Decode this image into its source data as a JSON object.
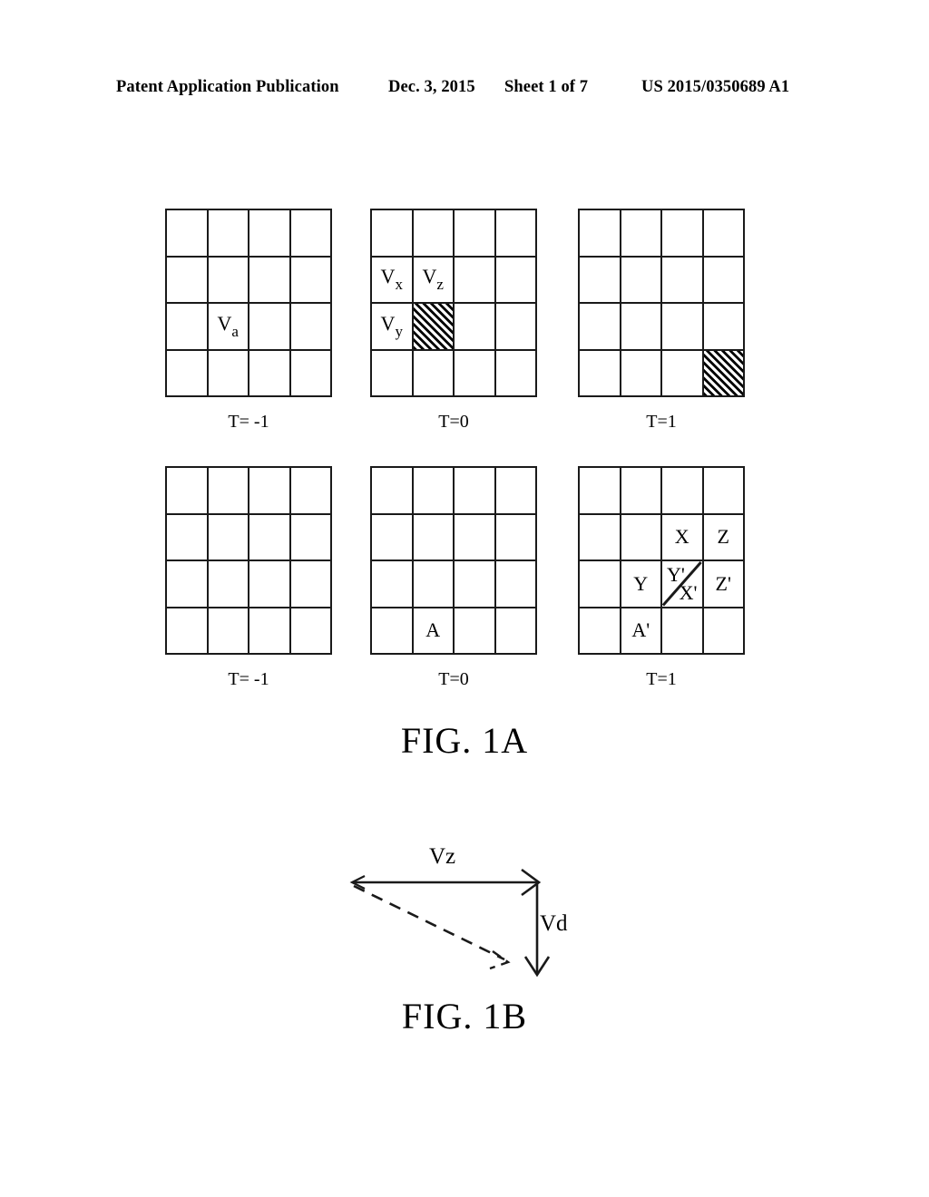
{
  "header": {
    "publication": "Patent Application Publication",
    "date": "Dec. 3, 2015",
    "sheet": "Sheet 1 of 7",
    "patent_number": "US 2015/0350689 A1"
  },
  "figures": [
    {
      "caption": "FIG. 1A",
      "panels": [
        {
          "time_label": "T= -1",
          "labels": [
            {
              "base": "V",
              "sub": "a",
              "row": 3,
              "col": 2
            }
          ],
          "hatched": []
        },
        {
          "time_label": "T=0",
          "labels": [
            {
              "base": "V",
              "sub": "x",
              "row": 2,
              "col": 1
            },
            {
              "base": "V",
              "sub": "z",
              "row": 2,
              "col": 2
            },
            {
              "base": "V",
              "sub": "y",
              "row": 3,
              "col": 1
            }
          ],
          "hatched": [
            {
              "row": 3,
              "col": 2
            }
          ]
        },
        {
          "time_label": "T=1",
          "labels": [],
          "hatched": [
            {
              "row": 4,
              "col": 4
            }
          ]
        },
        {
          "time_label": "T= -1",
          "labels": [],
          "hatched": []
        },
        {
          "time_label": "T=0",
          "labels": [
            {
              "base": "A",
              "sub": "",
              "row": 4,
              "col": 2
            }
          ],
          "hatched": []
        },
        {
          "time_label": "T=1",
          "labels": [
            {
              "base": "X",
              "sub": "",
              "row": 2,
              "col": 3
            },
            {
              "base": "Z",
              "sub": "",
              "row": 2,
              "col": 4
            },
            {
              "base": "Y",
              "sub": "",
              "row": 3,
              "col": 2
            },
            {
              "base": "Z'",
              "sub": "",
              "row": 3,
              "col": 4
            },
            {
              "base": "A'",
              "sub": "",
              "row": 4,
              "col": 2
            }
          ],
          "split_cell": {
            "row": 3,
            "col": 3,
            "upper_left_label": "Y'",
            "lower_right_label": "X'"
          },
          "hatched": []
        }
      ]
    },
    {
      "caption": "FIG. 1B",
      "vectors": [
        {
          "name": "Vz",
          "label": "Vz",
          "style": "solid",
          "direction": "right"
        },
        {
          "name": "Vd",
          "label": "Vd",
          "style": "solid",
          "direction": "down"
        },
        {
          "name": "resultant",
          "label": "",
          "style": "dashed",
          "direction": "down-right"
        }
      ]
    }
  ],
  "colors": {
    "ink": "#1a1a1a",
    "background": "#ffffff"
  }
}
